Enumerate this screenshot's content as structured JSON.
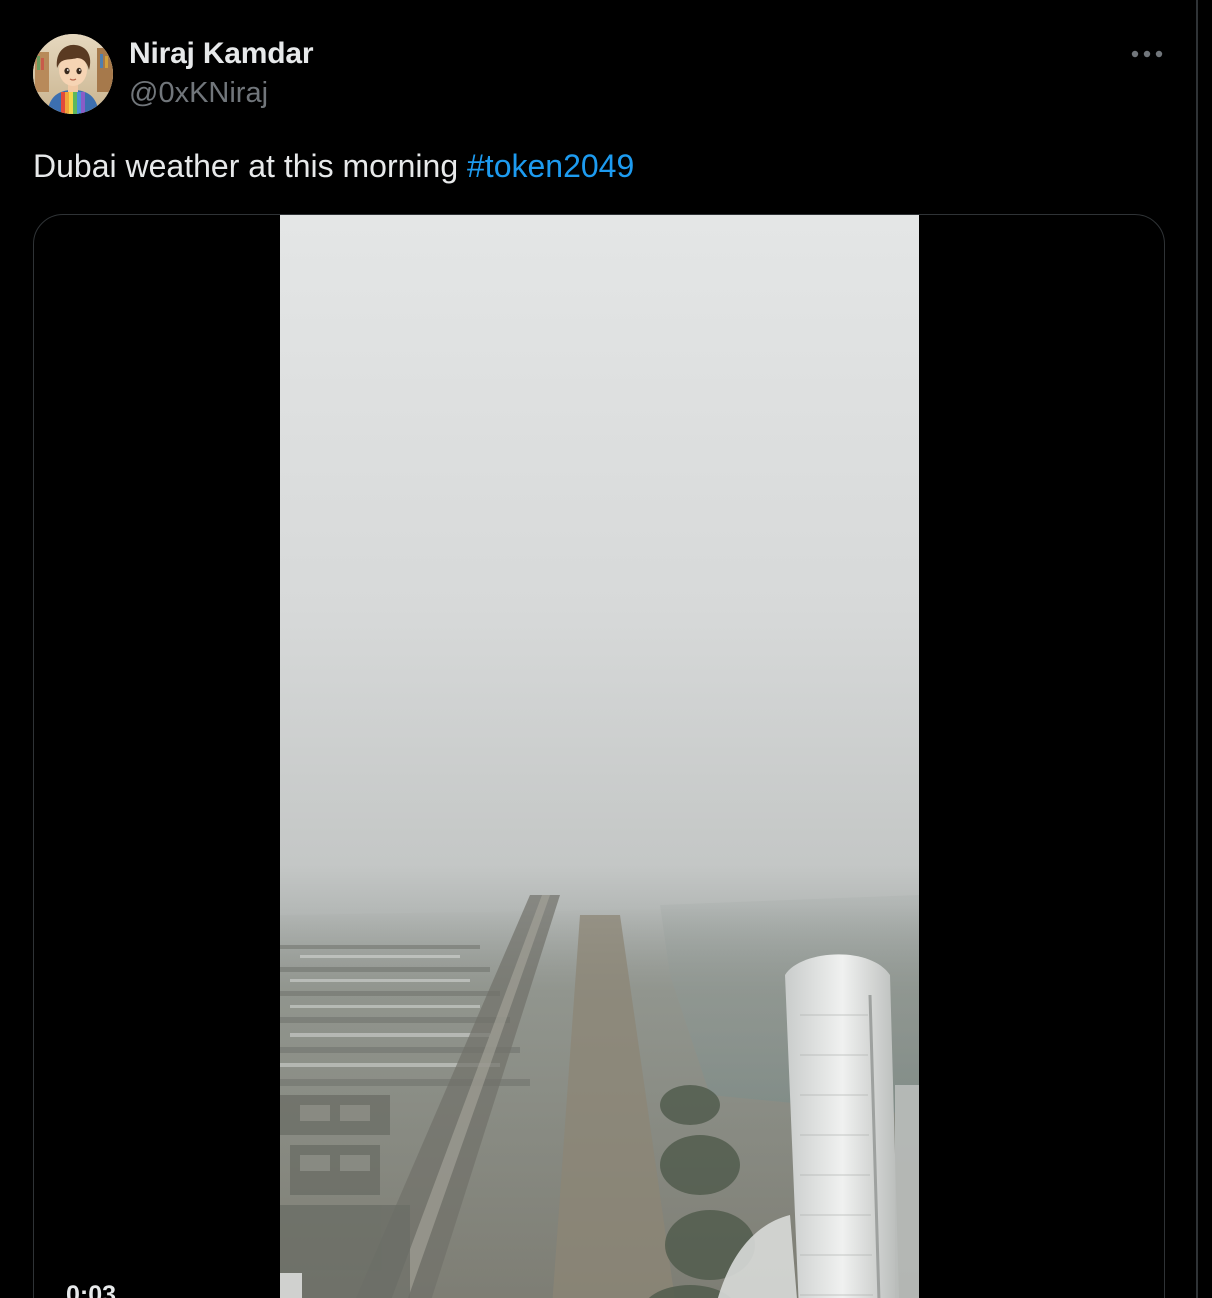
{
  "tweet": {
    "author": {
      "display_name": "Niraj Kamdar",
      "handle": "@0xKNiraj"
    },
    "text": "Dubai weather at this morning ",
    "hashtag": "#token2049",
    "more_icon": "more-horizontal-icon",
    "media": {
      "type": "video",
      "time": "0:03"
    }
  },
  "colors": {
    "background": "#000000",
    "text": "#e7e9ea",
    "secondary_text": "#71767b",
    "link": "#1d9bf0",
    "border": "#2f3336"
  }
}
